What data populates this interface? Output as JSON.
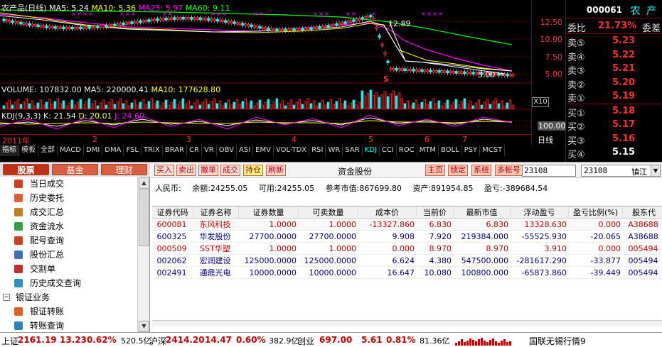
{
  "chart": {
    "title": "农产品(日线)",
    "ma_labels": [
      {
        "text": "MA5: 5.24",
        "color": "#ffffff"
      },
      {
        "text": "MA10: 5.36",
        "color": "#ffff00"
      },
      {
        "text": "MA25: 5.97",
        "color": "#ff00ff"
      },
      {
        "text": "MA60: 9.11",
        "color": "#00ff00"
      }
    ],
    "price_axis": [
      "12.50",
      "10.00",
      "7.50",
      "5.00"
    ],
    "annot_high": "12.89",
    "annot_low": "5.00",
    "annot_arrow": "→",
    "annot_s": "S",
    "volume_label": "VOLUME: 107832.00",
    "volume_ma5": "MA5: 220000.41",
    "volume_ma10": "MA10: 177628.80",
    "vol_scale": "X10",
    "kdj_label": "KDJ(9,3,3)",
    "kdj_k": "K: 21.54",
    "kdj_d": "D: 20.01",
    "kdj_j": "J: 24.60",
    "kdj_axis": "100.00",
    "period_label": "日线",
    "months": [
      "2011年",
      "2",
      "3",
      "4",
      "5",
      "6",
      "7"
    ],
    "indicator_tabs": [
      "指标",
      "模板",
      "全部",
      "MACD",
      "DMI",
      "DMA",
      "FSL",
      "TRIX",
      "BRAR",
      "CR",
      "VR",
      "OBV",
      "ASI",
      "EMV",
      "VOL-TDX",
      "RSI",
      "WR",
      "SAR",
      "KDJ",
      "CCI",
      "ROC",
      "MTM",
      "BOLL",
      "PSY",
      "MCST"
    ],
    "active_tab": "KDJ"
  },
  "quote": {
    "code": "000061",
    "name": "农 产",
    "ratio_label": "委比",
    "ratio_value": "21.73%",
    "diff_label": "委差",
    "sells": [
      {
        "label": "卖⑤",
        "price": "5.23"
      },
      {
        "label": "卖④",
        "price": "5.22"
      },
      {
        "label": "卖③",
        "price": "5.21"
      },
      {
        "label": "卖②",
        "price": "5.20"
      },
      {
        "label": "卖①",
        "price": "5.19"
      }
    ],
    "buys": [
      {
        "label": "买①",
        "price": "5.18"
      },
      {
        "label": "买②",
        "price": "5.17"
      },
      {
        "label": "买③",
        "price": "5.16"
      },
      {
        "label": "买④",
        "price": "5.15"
      }
    ]
  },
  "left": {
    "tabs": [
      "股票",
      "基金",
      "理财"
    ],
    "items": [
      {
        "label": "当日成交",
        "level": 1,
        "icon": "list-icon"
      },
      {
        "label": "历史委托",
        "level": 1,
        "icon": "history-icon"
      },
      {
        "label": "成交汇总",
        "level": 1,
        "icon": "summary-icon"
      },
      {
        "label": "资金流水",
        "level": 1,
        "icon": "cashflow-icon"
      },
      {
        "label": "配号查询",
        "level": 1,
        "icon": "number-icon"
      },
      {
        "label": "股份汇总",
        "level": 1,
        "icon": "holding-icon"
      },
      {
        "label": "交割单",
        "level": 1,
        "icon": "delivery-icon"
      },
      {
        "label": "历史成交查询",
        "level": 1,
        "icon": "history-query-icon"
      },
      {
        "label": "银证业务",
        "level": 0,
        "icon": "collapse-icon",
        "box": "−"
      },
      {
        "label": "银证转账",
        "level": 1,
        "icon": "transfer-icon"
      },
      {
        "label": "转账查询",
        "level": 1,
        "icon": "transfer-query-icon"
      }
    ]
  },
  "toolbar": {
    "buttons": [
      "买入",
      "卖出",
      "撤单",
      "成交",
      "持仓",
      "刷新"
    ],
    "title": "资金股份",
    "right_buttons": [
      "主页",
      "锁定",
      "系统",
      "多帐号"
    ],
    "account_input": "23108",
    "account_select": "23108",
    "bank": "镇江"
  },
  "summary": {
    "currency": "人民币:",
    "balance": "余额:24255.05",
    "available": "可用:24255.05",
    "market_value": "参考市值:867699.80",
    "assets": "资产:891954.85",
    "profit": "盈亏:-389684.54"
  },
  "grid": {
    "headers": [
      "证券代码",
      "证券名称",
      "证券数量",
      "可卖数量",
      "成本价",
      "当前价",
      "最新市值",
      "浮动盈亏",
      "盈亏比例(%)",
      "股东代"
    ],
    "rows": [
      [
        "600081",
        "东风科技",
        "1.0000",
        "1.0000",
        "-13327.860",
        "6.830",
        "6.830",
        "13328.630",
        "0.000",
        "A38688"
      ],
      [
        "600325",
        "华发股份",
        "27700.0000",
        "27700.0000",
        "9.908",
        "7.920",
        "219384.000",
        "-55525.930",
        "-20.065",
        "A38688"
      ],
      [
        "000509",
        "SST华塑",
        "1.0000",
        "1.0000",
        "0.000",
        "8.970",
        "8.970",
        "3.910",
        "0.000",
        "005494"
      ],
      [
        "002062",
        "宏润建设",
        "125000.0000",
        "125000.0000",
        "6.624",
        "4.380",
        "547500.000",
        "-281617.290",
        "-33.877",
        "005494"
      ],
      [
        "002491",
        "通鼎光电",
        "10000.0000",
        "10000.0000",
        "16.647",
        "10.080",
        "100800.000",
        "-65873.860",
        "-39.449",
        "005494"
      ]
    ]
  },
  "status": {
    "sh_label": "上证",
    "sh_index": "2161.19",
    "sh_change": "13.23",
    "sh_pct": "0.62%",
    "sh_amount": "520.5亿",
    "hs_label": "沪深",
    "hs_index": "2414.20",
    "hs_change": "14.47",
    "hs_pct": "0.60%",
    "hs_amount": "382.9亿",
    "cy_label": "创业",
    "cy_index": "697.00",
    "cy_change": "5.61",
    "cy_pct": "0.81%",
    "cy_amount": "81.36亿",
    "feed": "国联无锡行情9"
  }
}
